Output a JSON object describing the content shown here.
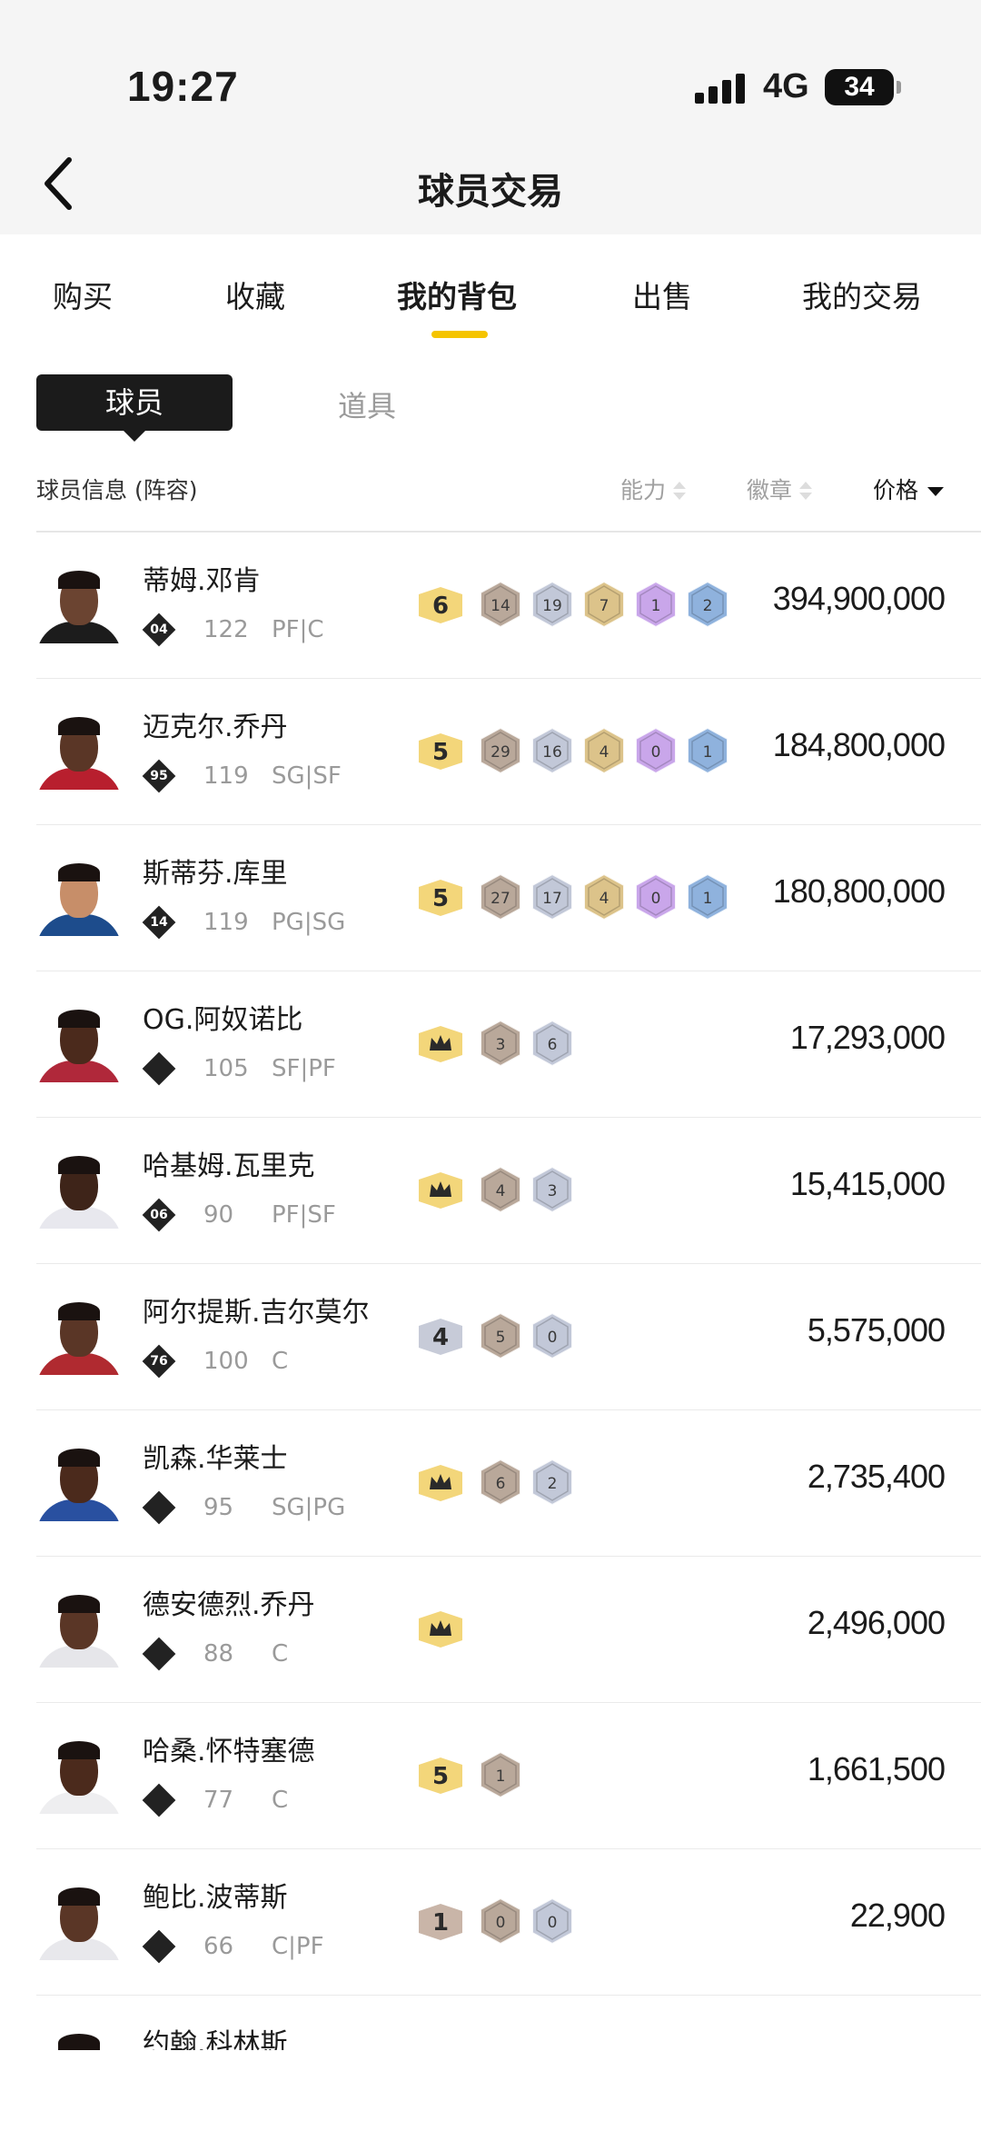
{
  "status": {
    "time": "19:27",
    "network": "4G",
    "battery": "34"
  },
  "nav": {
    "title": "球员交易"
  },
  "tabs": [
    {
      "label": "购买"
    },
    {
      "label": "收藏"
    },
    {
      "label": "我的背包",
      "active": true
    },
    {
      "label": "出售"
    },
    {
      "label": "我的交易"
    }
  ],
  "segment": {
    "active": "球员",
    "inactive": "道具"
  },
  "columns": {
    "info": "球员信息 (阵容)",
    "ability": "能力",
    "badge": "徽章",
    "price": "价格"
  },
  "colors": {
    "accent": "#f5c400",
    "bronze": "#b9a89a",
    "silver": "#c2c8d8",
    "gold": "#dcc38a",
    "purple": "#c9a6ea",
    "blue": "#8fb2dd"
  },
  "players": [
    {
      "name": "蒂姆.邓肯",
      "card": "04",
      "rating": "122",
      "pos": "PF|C",
      "ability": "6",
      "badges": [
        "14",
        "19",
        "7",
        "1",
        "2"
      ],
      "price": "394,900,000",
      "skin": "#6b4431",
      "jersey": "#1c1c1c"
    },
    {
      "name": "迈克尔.乔丹",
      "card": "95",
      "rating": "119",
      "pos": "SG|SF",
      "ability": "5",
      "badges": [
        "29",
        "16",
        "4",
        "0",
        "1"
      ],
      "price": "184,800,000",
      "skin": "#5a3626",
      "jersey": "#b81f2e"
    },
    {
      "name": "斯蒂芬.库里",
      "card": "14",
      "rating": "119",
      "pos": "PG|SG",
      "ability": "5",
      "badges": [
        "27",
        "17",
        "4",
        "0",
        "1"
      ],
      "price": "180,800,000",
      "skin": "#c78e69",
      "jersey": "#1d4c8c"
    },
    {
      "name": "OG.阿奴诺比",
      "card": "",
      "rating": "105",
      "pos": "SF|PF",
      "ability": "crown",
      "badges": [
        "3",
        "6"
      ],
      "price": "17,293,000",
      "skin": "#4b2a1c",
      "jersey": "#b0283a"
    },
    {
      "name": "哈基姆.瓦里克",
      "card": "06",
      "rating": "90",
      "pos": "PF|SF",
      "ability": "crown",
      "badges": [
        "4",
        "3"
      ],
      "price": "15,415,000",
      "skin": "#3e2419",
      "jersey": "#e8e8ee"
    },
    {
      "name": "阿尔提斯.吉尔莫尔",
      "card": "76",
      "rating": "100",
      "pos": "C",
      "ability": "4",
      "badges": [
        "5",
        "0"
      ],
      "price": "5,575,000",
      "skin": "#5a3626",
      "jersey": "#b02a30"
    },
    {
      "name": "凯森.华莱士",
      "card": "",
      "rating": "95",
      "pos": "SG|PG",
      "ability": "crown",
      "badges": [
        "6",
        "2"
      ],
      "price": "2,735,400",
      "skin": "#4b2a1c",
      "jersey": "#2950a0"
    },
    {
      "name": "德安德烈.乔丹",
      "card": "",
      "rating": "88",
      "pos": "C",
      "ability": "crown",
      "badges": [],
      "price": "2,496,000",
      "skin": "#5a3626",
      "jersey": "#e6e6ea"
    },
    {
      "name": "哈桑.怀特塞德",
      "card": "",
      "rating": "77",
      "pos": "C",
      "ability": "5",
      "badges": [
        "1"
      ],
      "price": "1,661,500",
      "skin": "#4b2a1c",
      "jersey": "#eeeef0"
    },
    {
      "name": "鲍比.波蒂斯",
      "card": "",
      "rating": "66",
      "pos": "C|PF",
      "ability": "1",
      "badges": [
        "0",
        "0"
      ],
      "price": "22,900",
      "skin": "#5a3626",
      "jersey": "#e8e8ec"
    },
    {
      "name": "约翰.科林斯",
      "card": "",
      "rating": "",
      "pos": "",
      "ability": "",
      "badges": [],
      "price": "",
      "skin": "#4b2a1c",
      "jersey": "#c0c0c0"
    }
  ]
}
